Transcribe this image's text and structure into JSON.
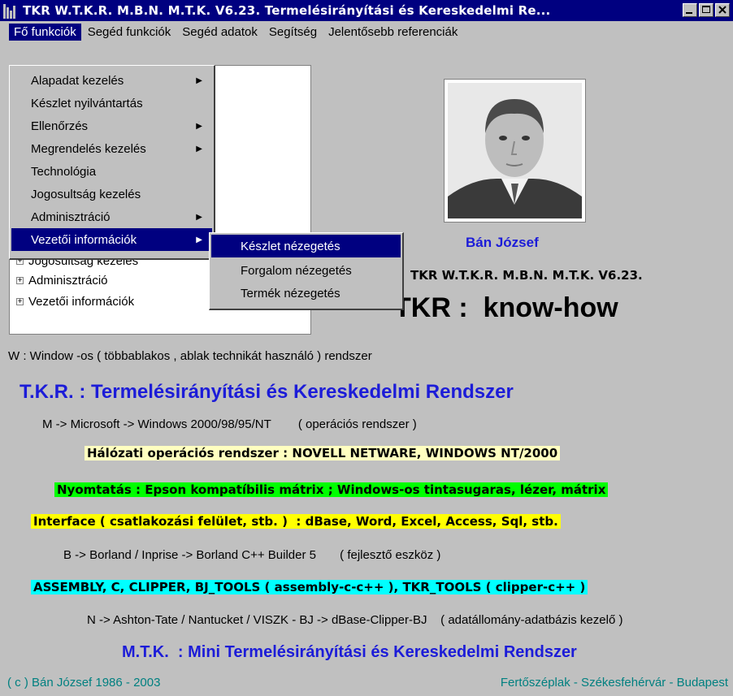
{
  "window": {
    "title": "TKR W.T.K.R. M.B.N. M.T.K. V6.23. Termelésirányítási és Kereskedelmi Re..."
  },
  "menubar": {
    "items": [
      "Fő funkciók",
      "Segéd funkciók",
      "Segéd adatok",
      "Segítség",
      "Jelentősebb referenciák"
    ]
  },
  "dropdown": {
    "items": [
      {
        "label": "Alapadat kezelés",
        "has_submenu": true
      },
      {
        "label": "Készlet nyilvántartás",
        "has_submenu": false
      },
      {
        "label": "Ellenőrzés",
        "has_submenu": true
      },
      {
        "label": "Megrendelés kezelés",
        "has_submenu": true
      },
      {
        "label": "Technológia",
        "has_submenu": false
      },
      {
        "label": "Jogosultság kezelés",
        "has_submenu": false
      },
      {
        "label": "Adminisztráció",
        "has_submenu": true
      },
      {
        "label": "Vezetői információk",
        "has_submenu": true
      }
    ]
  },
  "submenu": {
    "items": [
      "Készlet nézegetés",
      "Forgalom nézegetés",
      "Termék nézegetés"
    ]
  },
  "tree": {
    "items": [
      "Jogosultság kezelés",
      "Adminisztráció",
      "Vezetői információk"
    ]
  },
  "profile": {
    "name": "Bán József",
    "version_line": "TKR W.T.K.R. M.B.N. M.T.K. V6.23.",
    "slogan": "TKR :  know-how"
  },
  "info": {
    "window_line": "W : Window -os ( többablakos , ablak technikát használó ) rendszer",
    "tkr_heading": "T.K.R. : Termelésirányítási és Kereskedelmi Rendszer",
    "microsoft_line": "M -> Microsoft -> Windows 2000/98/95/NT        ( operációs rendszer )",
    "network_line": "Hálózati operációs rendszer : NOVELL NETWARE, WINDOWS NT/2000",
    "print_line": "Nyomtatás : Epson kompatíbilis mátrix ;  Windows-os tintasugaras, lézer, mátrix",
    "interface_line": "Interface ( csatlakozási felület, stb. )  : dBase, Word, Excel, Access, Sql, stb.",
    "borland_line": "B -> Borland / Inprise -> Borland C++ Builder 5       ( fejlesztő eszköz )",
    "tools_line": "ASSEMBLY, C, CLIPPER, BJ_TOOLS ( assembly-c-c++ ), TKR_TOOLS ( clipper-c++ )",
    "ashton_line": "N -> Ashton-Tate / Nantucket / VISZK - BJ -> dBase-Clipper-BJ    ( adatállomány-adatbázis kezelő )",
    "mtk_heading": "M.T.K.  : Mini Termelésirányítási és Kereskedelmi Rendszer",
    "copyright": "( c ) Bán József 1986 - 2003",
    "locations": "Fertőszéplak - Székesfehérvár - Budapest"
  },
  "colors": {
    "titlebar": "#000080",
    "heading_blue": "#1c1cd8",
    "teal_text": "#008080",
    "highlight_yellow_light": "#ffffc0",
    "highlight_green": "#00ff00",
    "highlight_yellow": "#ffff00",
    "highlight_cyan": "#00ffff"
  }
}
